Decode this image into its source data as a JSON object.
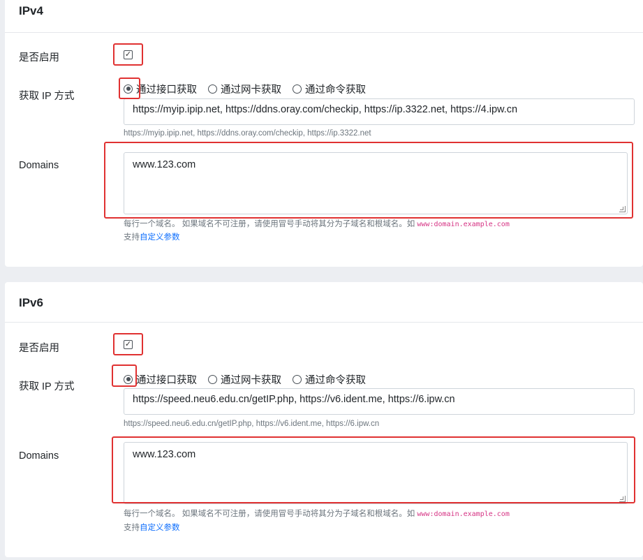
{
  "ipv4": {
    "title": "IPv4",
    "enable_label": "是否启用",
    "enabled": true,
    "method_label": "获取 IP 方式",
    "methods": [
      "通过接口获取",
      "通过网卡获取",
      "通过命令获取"
    ],
    "selected_method": "通过接口获取",
    "url_value": "https://myip.ipip.net, https://ddns.oray.com/checkip, https://ip.3322.net, https://4.ipw.cn",
    "url_help": "https://myip.ipip.net, https://ddns.oray.com/checkip, https://ip.3322.net",
    "domains_label": "Domains",
    "domains_value": "www.123.com",
    "domains_help": "每行一个域名。 如果域名不可注册，请使用冒号手动将其分为子域名和根域名。如 ",
    "domains_help_example": "www:domain.example.com",
    "custom_prefix": "支持",
    "custom_link": "自定义参数"
  },
  "ipv6": {
    "title": "IPv6",
    "enable_label": "是否启用",
    "enabled": true,
    "method_label": "获取 IP 方式",
    "methods": [
      "通过接口获取",
      "通过网卡获取",
      "通过命令获取"
    ],
    "selected_method": "通过接口获取",
    "url_value": "https://speed.neu6.edu.cn/getIP.php, https://v6.ident.me, https://6.ipw.cn",
    "url_help": "https://speed.neu6.edu.cn/getIP.php, https://v6.ident.me, https://6.ipw.cn",
    "domains_label": "Domains",
    "domains_value": "www.123.com",
    "domains_help": "每行一个域名。 如果域名不可注册，请使用冒号手动将其分为子域名和根域名。如 ",
    "domains_help_example": "www:domain.example.com",
    "custom_prefix": "支持",
    "custom_link": "自定义参数"
  },
  "colors": {
    "highlight": "#e03131",
    "link": "#0d6efd",
    "code": "#d63384"
  }
}
